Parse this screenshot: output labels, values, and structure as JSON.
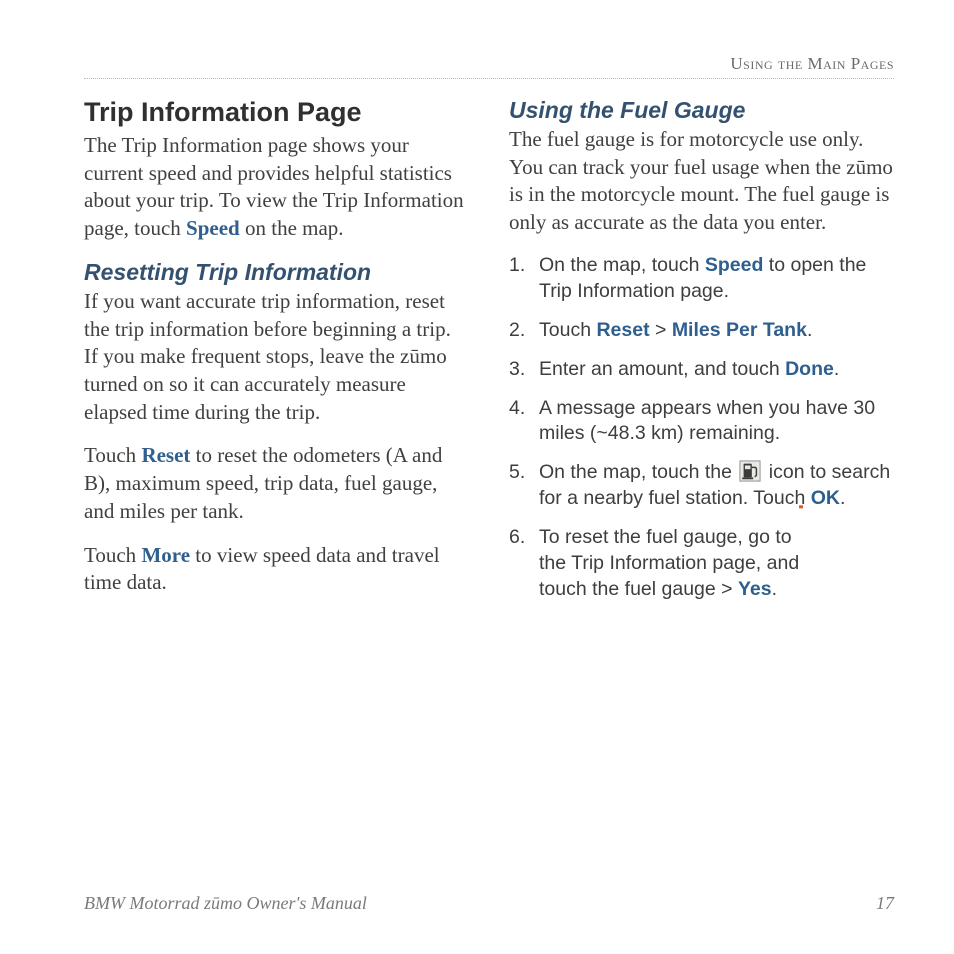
{
  "running_head": "Using the Main Pages",
  "left": {
    "h1": "Trip Information Page",
    "p1_a": "The Trip Information page shows your current speed and provides helpful statistics about your trip. To view the Trip Information page, touch ",
    "p1_link": "Speed",
    "p1_b": " on the map.",
    "h2": "Resetting Trip Information",
    "p2": "If you want accurate trip information, reset the trip information before beginning a trip. If you make frequent stops, leave the zūmo turned on so it can accurately measure elapsed time during the trip.",
    "p3_a": "Touch ",
    "p3_link": "Reset",
    "p3_b": " to reset the odometers (A and B), maximum speed, trip data, fuel gauge, and miles per tank.",
    "p4_a": "Touch ",
    "p4_link": "More",
    "p4_b": " to view speed data and travel time data."
  },
  "right": {
    "h2": "Using the Fuel Gauge",
    "intro": "The fuel gauge is for motorcycle use only. You can track your fuel usage when the zūmo is in the motorcycle mount. The fuel gauge is only as accurate as the data you enter.",
    "steps": {
      "s1_a": "On the map, touch ",
      "s1_link": "Speed",
      "s1_b": " to open the Trip Information page.",
      "s2_a": "Touch ",
      "s2_link1": "Reset",
      "s2_mid": " > ",
      "s2_link2": "Miles Per Tank",
      "s2_b": ".",
      "s3_a": "Enter an amount, and touch ",
      "s3_link": "Done",
      "s3_b": ".",
      "s4": "A message appears when you have 30 miles (~48.3 km) remaining.",
      "s5_a": "On the map, touch the ",
      "s5_b": " icon to search for a nearby fuel station. Touch ",
      "s5_link": "OK",
      "s5_c": ".",
      "s6_a": "To reset the fuel gauge, go to the Trip Information page, and touch the fuel gauge > ",
      "s6_link": "Yes",
      "s6_b": "."
    }
  },
  "footer": {
    "title": "BMW Motorrad zūmo Owner's Manual",
    "page": "17"
  }
}
